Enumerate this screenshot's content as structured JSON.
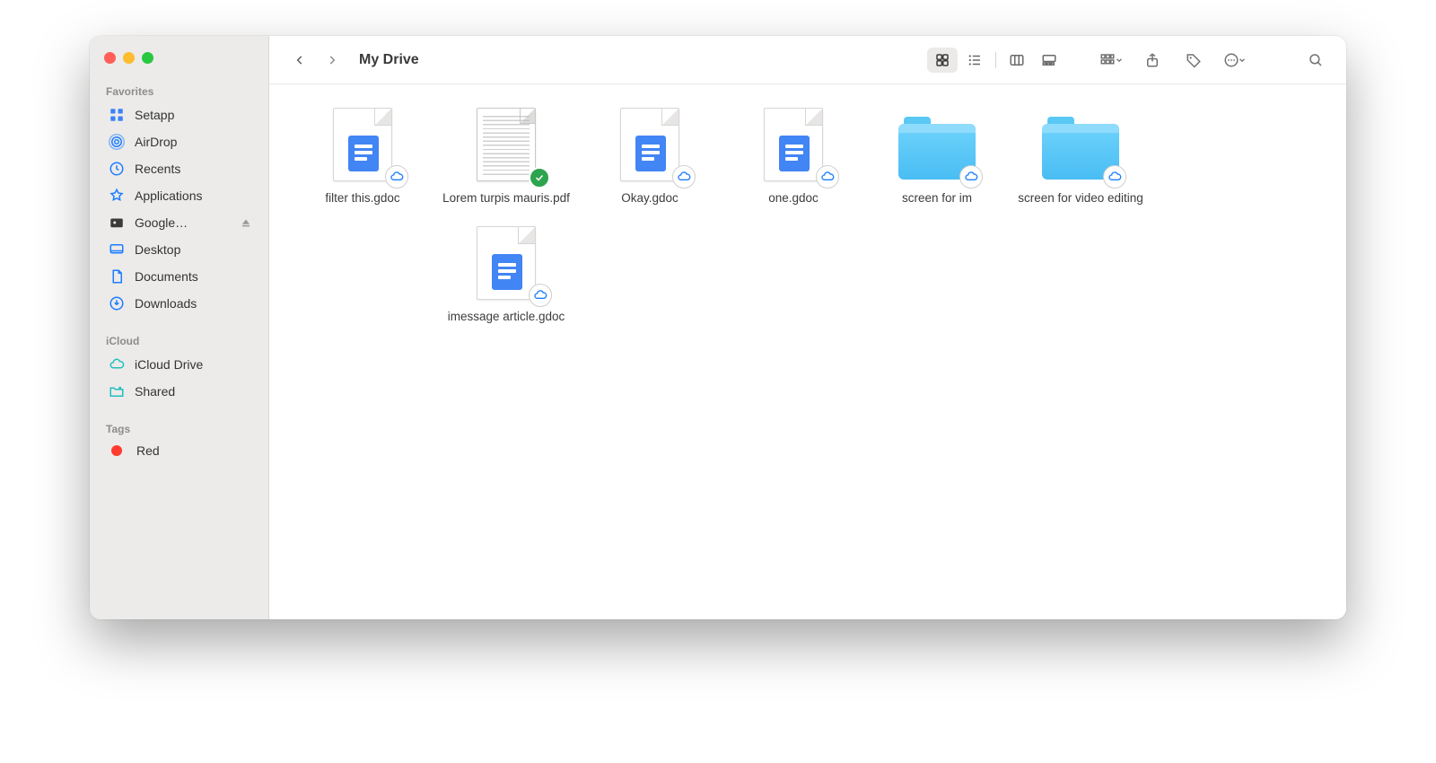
{
  "window_title": "My Drive",
  "sidebar": {
    "sections": [
      {
        "label": "Favorites",
        "items": [
          {
            "icon": "setapp",
            "label": "Setapp"
          },
          {
            "icon": "airdrop",
            "label": "AirDrop"
          },
          {
            "icon": "recents",
            "label": "Recents"
          },
          {
            "icon": "applications",
            "label": "Applications"
          },
          {
            "icon": "google-drive",
            "label": "Google…",
            "ejectable": true,
            "selected": true
          },
          {
            "icon": "desktop",
            "label": "Desktop"
          },
          {
            "icon": "documents",
            "label": "Documents"
          },
          {
            "icon": "downloads",
            "label": "Downloads"
          }
        ]
      },
      {
        "label": "iCloud",
        "items": [
          {
            "icon": "icloud",
            "label": "iCloud Drive"
          },
          {
            "icon": "shared",
            "label": "Shared"
          }
        ]
      },
      {
        "label": "Tags",
        "items": [
          {
            "icon": "tag-red",
            "label": "Red"
          }
        ]
      }
    ]
  },
  "toolbar": {
    "view_mode": "icon"
  },
  "files": [
    {
      "name": "filter this.gdoc",
      "kind": "gdoc",
      "badge": "cloud"
    },
    {
      "name": "Lorem turpis mauris.pdf",
      "kind": "pdf",
      "badge": "synced"
    },
    {
      "name": "Okay.gdoc",
      "kind": "gdoc",
      "badge": "cloud"
    },
    {
      "name": "one.gdoc",
      "kind": "gdoc",
      "badge": "cloud"
    },
    {
      "name": "screen for im",
      "kind": "folder",
      "badge": "cloud"
    },
    {
      "name": "screen for video editing",
      "kind": "folder",
      "badge": "cloud"
    },
    {
      "name": "imessage article.gdoc",
      "kind": "gdoc",
      "badge": "cloud",
      "row2_under": 2
    }
  ]
}
